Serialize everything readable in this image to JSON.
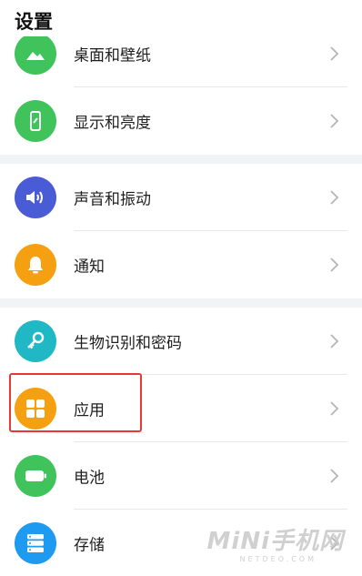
{
  "header": {
    "title": "设置"
  },
  "items": [
    {
      "label": "桌面和壁纸",
      "icon": "wallpaper-icon",
      "color": "#3fc35a"
    },
    {
      "label": "显示和亮度",
      "icon": "phone-brightness-icon",
      "color": "#3fc35a"
    },
    {
      "label": "声音和振动",
      "icon": "speaker-icon",
      "color": "#4a5bd6"
    },
    {
      "label": "通知",
      "icon": "bell-icon",
      "color": "#f4a010"
    },
    {
      "label": "生物识别和密码",
      "icon": "key-icon",
      "color": "#1fb8c4"
    },
    {
      "label": "应用",
      "icon": "apps-grid-icon",
      "color": "#f4a010"
    },
    {
      "label": "电池",
      "icon": "battery-icon",
      "color": "#3fc35a"
    },
    {
      "label": "存储",
      "icon": "storage-icon",
      "color": "#1e9af0"
    }
  ],
  "watermark": {
    "main": "MiNi手机网",
    "sub": "NETDEO.COM"
  }
}
